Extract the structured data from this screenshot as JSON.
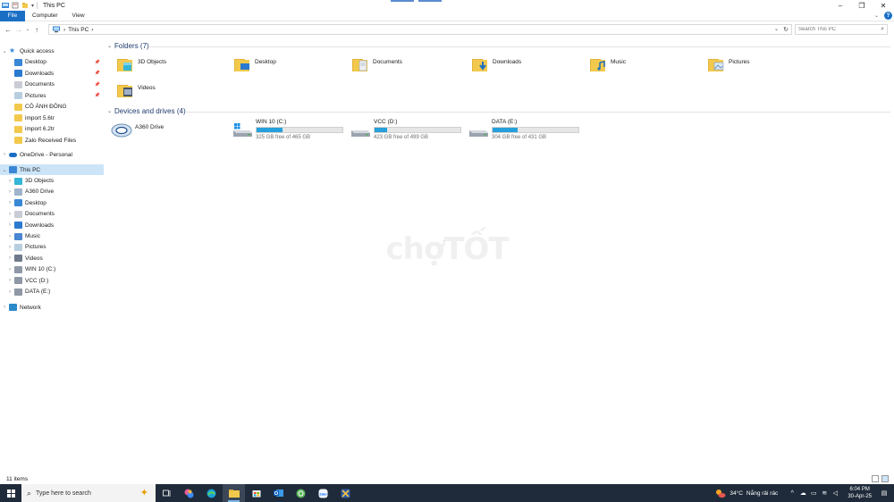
{
  "window": {
    "title": "This PC",
    "ribbon_tabs": [
      "File",
      "Computer",
      "View"
    ]
  },
  "address": {
    "path": "This PC",
    "separator": "›",
    "search_placeholder": "Search This PC"
  },
  "sidebar": {
    "quick_access": {
      "label": "Quick access",
      "items": [
        {
          "label": "Desktop",
          "pinned": true,
          "icon": "desktop-icon"
        },
        {
          "label": "Downloads",
          "pinned": true,
          "icon": "downloads-icon"
        },
        {
          "label": "Documents",
          "pinned": true,
          "icon": "documents-icon"
        },
        {
          "label": "Pictures",
          "pinned": true,
          "icon": "pictures-icon"
        },
        {
          "label": "CÔ ÁNH ĐÔNG",
          "pinned": false,
          "icon": "folder-icon"
        },
        {
          "label": "import 5.6tr",
          "pinned": false,
          "icon": "folder-icon"
        },
        {
          "label": "import 6.2tr",
          "pinned": false,
          "icon": "folder-icon"
        },
        {
          "label": "Zalo Received Files",
          "pinned": false,
          "icon": "folder-icon"
        }
      ]
    },
    "onedrive": {
      "label": "OneDrive - Personal"
    },
    "this_pc": {
      "label": "This PC",
      "items": [
        {
          "label": "3D Objects",
          "icon": "3d-objects-icon"
        },
        {
          "label": "A360 Drive",
          "icon": "a360-drive-icon"
        },
        {
          "label": "Desktop",
          "icon": "desktop-icon"
        },
        {
          "label": "Documents",
          "icon": "documents-icon"
        },
        {
          "label": "Downloads",
          "icon": "downloads-icon"
        },
        {
          "label": "Music",
          "icon": "music-icon"
        },
        {
          "label": "Pictures",
          "icon": "pictures-icon"
        },
        {
          "label": "Videos",
          "icon": "videos-icon"
        },
        {
          "label": "WIN 10 (C:)",
          "icon": "drive-icon"
        },
        {
          "label": "VCC (D:)",
          "icon": "drive-icon"
        },
        {
          "label": "DATA (E:)",
          "icon": "drive-icon"
        }
      ]
    },
    "network": {
      "label": "Network"
    }
  },
  "content": {
    "folders_heading": "Folders (7)",
    "folders": [
      {
        "label": "3D Objects",
        "icon": "3d-objects-folder-icon"
      },
      {
        "label": "Desktop",
        "icon": "desktop-folder-icon"
      },
      {
        "label": "Documents",
        "icon": "documents-folder-icon"
      },
      {
        "label": "Downloads",
        "icon": "downloads-folder-icon"
      },
      {
        "label": "Music",
        "icon": "music-folder-icon"
      },
      {
        "label": "Pictures",
        "icon": "pictures-folder-icon"
      },
      {
        "label": "Videos",
        "icon": "videos-folder-icon"
      }
    ],
    "devices_heading": "Devices and drives (4)",
    "a360": {
      "label": "A360 Drive"
    },
    "drives": [
      {
        "label": "WIN 10 (C:)",
        "free_text": "325 GB free of 465 GB",
        "used_fraction": 0.3
      },
      {
        "label": "VCC (D:)",
        "free_text": "423 GB free of 499 GB",
        "used_fraction": 0.15
      },
      {
        "label": "DATA (E:)",
        "free_text": "304 GB free of 431 GB",
        "used_fraction": 0.29
      }
    ]
  },
  "status": {
    "item_count": "11 items"
  },
  "taskbar": {
    "search_placeholder": "Type here to search",
    "weather_temp": "34°C",
    "weather_text": "Nắng rải rác",
    "time": "6:04 PM",
    "date": "30-Apr-25"
  },
  "watermark": {
    "text": "chợTỐT"
  },
  "colors": {
    "accent": "#1a6fc4",
    "selection": "#cce4f7",
    "drive_bar": "#26a0da",
    "folder": "#f2c94c",
    "taskbar": "#1f2b3a"
  }
}
